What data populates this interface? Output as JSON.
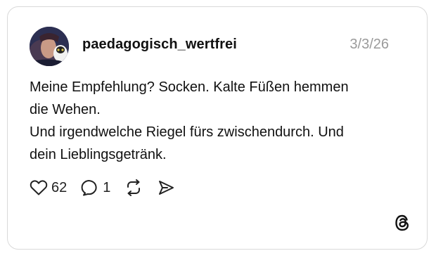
{
  "post": {
    "username": "paedagogisch_wertfrei",
    "date": "3/3/26",
    "text_lines": [
      "Meine Empfehlung? Socken. Kalte Füßen hemmen",
      "die Wehen.",
      "Und irgendwelche Riegel fürs zwischendurch. Und",
      "dein Lieblingsgetränk."
    ],
    "likes": "62",
    "replies": "1"
  },
  "icons": {
    "avatar": "avatar-image",
    "like": "heart-icon",
    "reply": "speech-bubble-icon",
    "repost": "repost-icon",
    "share": "send-icon",
    "brand": "threads-logo-icon"
  },
  "colors": {
    "border": "#d9d9d9",
    "text": "#111111",
    "muted": "#9a9a9a"
  }
}
